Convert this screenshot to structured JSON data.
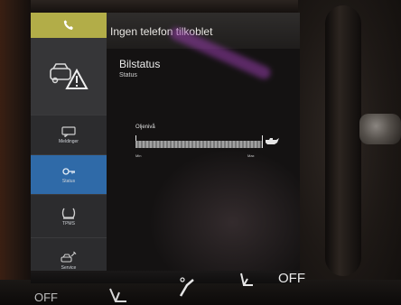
{
  "top_bar": {
    "text": "Ingen telefon tilkoblet"
  },
  "sidebar": {
    "items": [
      {
        "label": "Meldinger",
        "icon": "message-icon"
      },
      {
        "label": "Status",
        "icon": "car-key-icon",
        "selected": true
      },
      {
        "label": "TPMS",
        "icon": "tire-pressure-icon"
      },
      {
        "label": "Service",
        "icon": "wrench-car-icon"
      }
    ]
  },
  "content": {
    "title": "Bilstatus",
    "subtitle": "Status",
    "oil_label": "Oljenivå",
    "oil_level": 0.98,
    "min_label": "Min",
    "max_label": "Max"
  },
  "climate": {
    "off_label": "OFF",
    "left_off_label": "OFF"
  },
  "colors": {
    "phone_tab": "#b2ad48",
    "selected": "#2f6aa8",
    "sidebar": "#2c2c2e"
  }
}
